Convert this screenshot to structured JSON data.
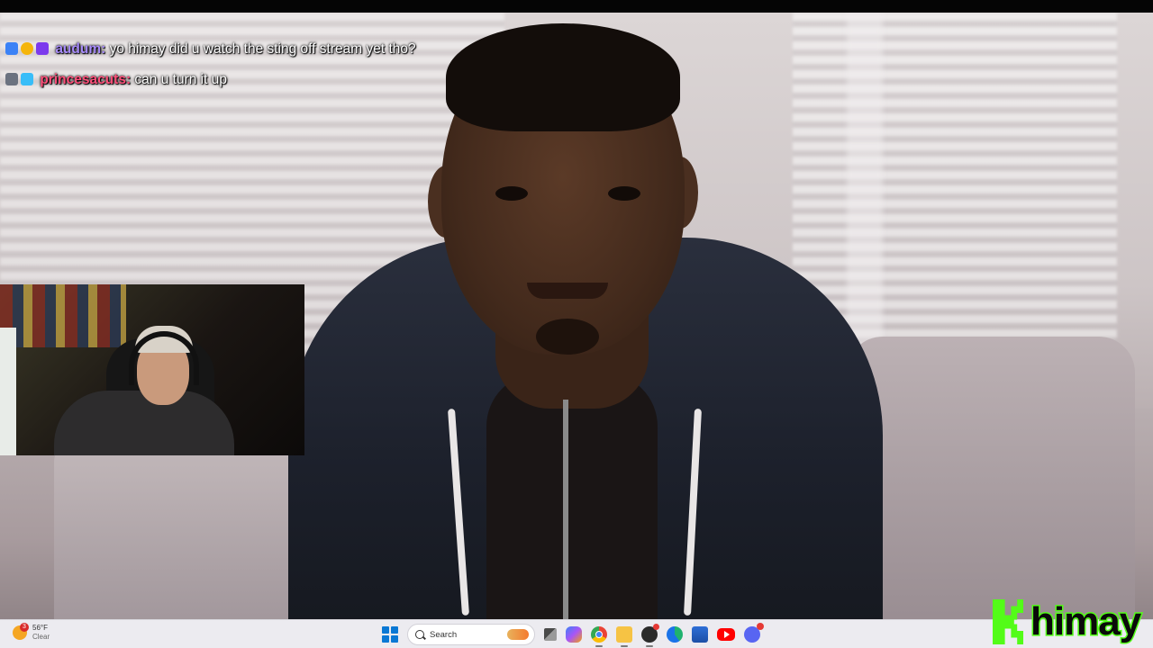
{
  "chat": {
    "messages": [
      {
        "username": "audum",
        "separator": ":",
        "text": " yo himay did u watch the sting off stream yet tho?",
        "color": "#a78bfa"
      },
      {
        "username": "princesacuts",
        "separator": ":",
        "text": " can u turn it up",
        "color": "#ff4f7a"
      }
    ]
  },
  "taskbar": {
    "weather": {
      "badge": "3",
      "temp": "56°F",
      "condition": "Clear"
    },
    "search_placeholder": "Search",
    "apps": [
      "start-icon",
      "search-icon",
      "task-view-icon",
      "copilot-icon",
      "chrome-icon",
      "file-explorer-icon",
      "obs-icon",
      "edge-icon",
      "store-icon",
      "youtube-icon",
      "discord-icon"
    ]
  },
  "overlay": {
    "logo_text": "himay",
    "logo_color": "#53fc18"
  }
}
